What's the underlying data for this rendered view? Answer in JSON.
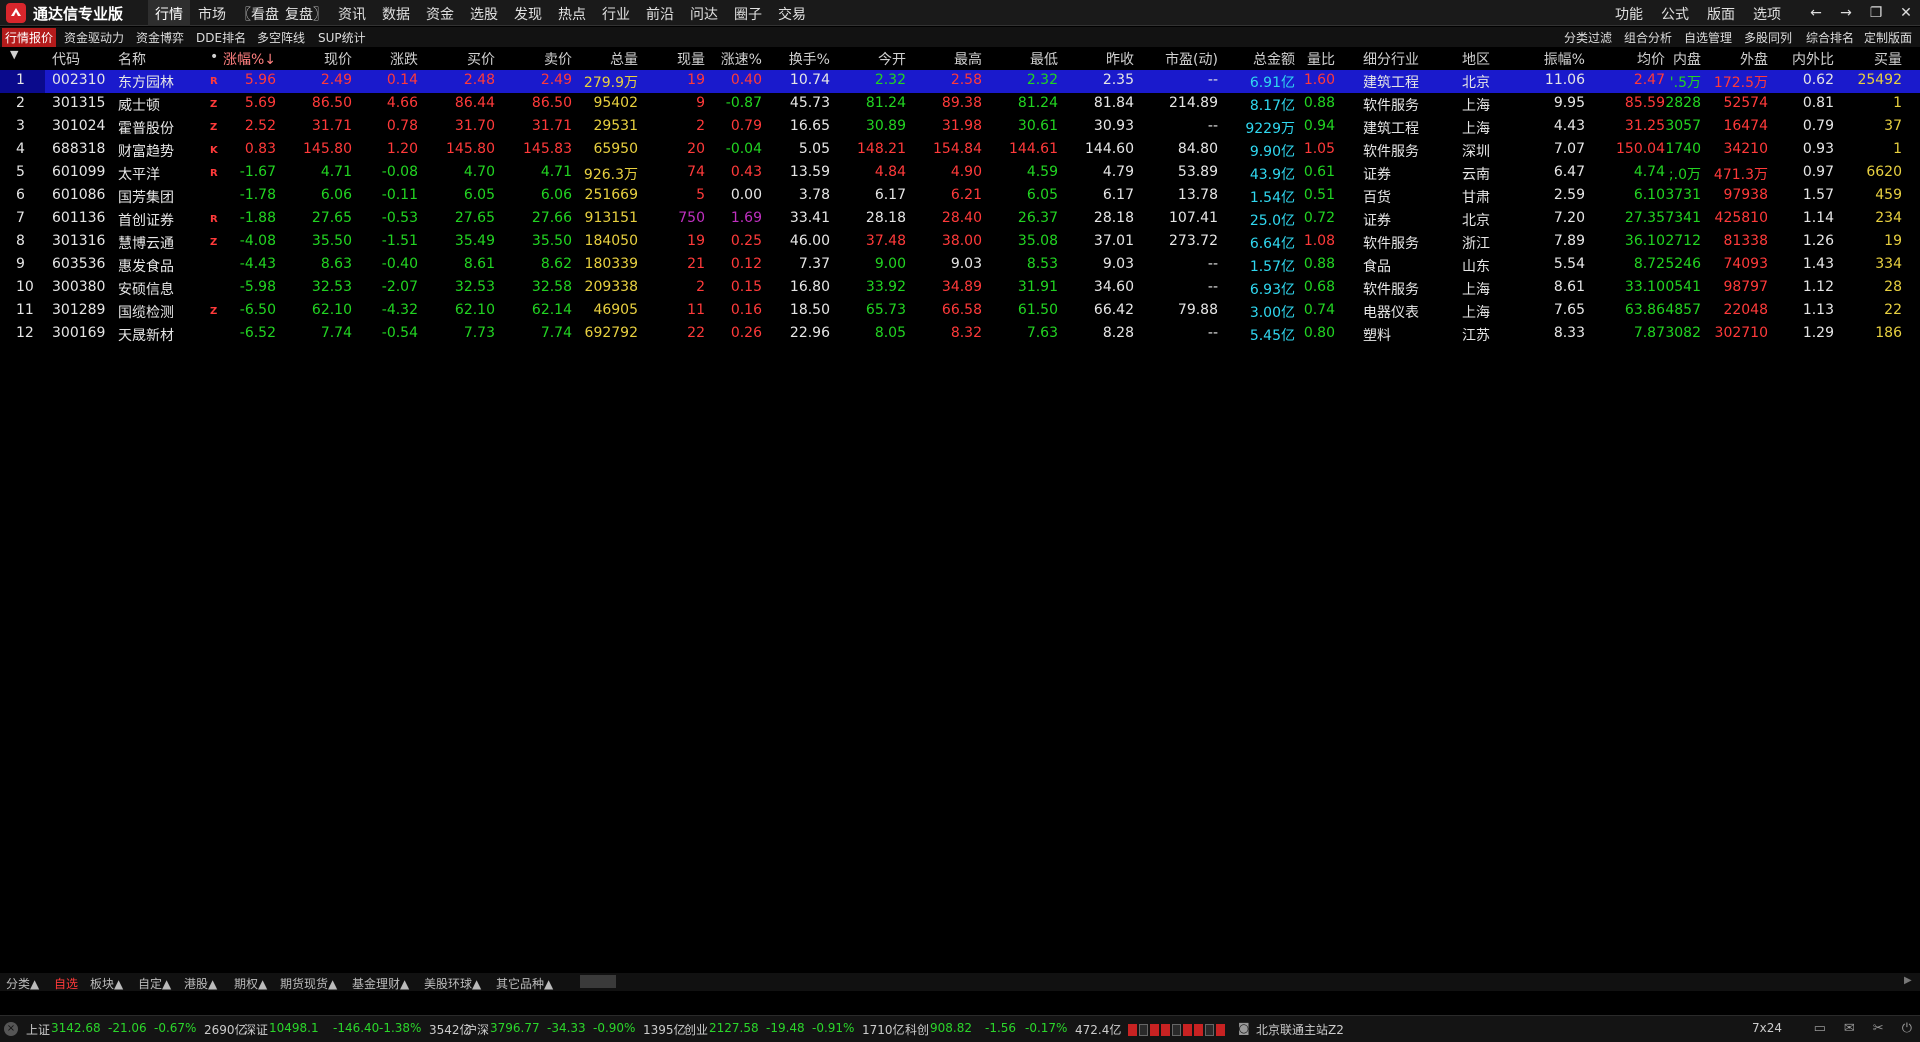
{
  "app": {
    "title": "通达信专业版"
  },
  "menu": [
    "行情",
    "市场",
    "〖看盘",
    "复盘〗",
    "资讯",
    "数据",
    "资金",
    "选股",
    "发现",
    "热点",
    "行业",
    "前沿",
    "问达",
    "圈子",
    "交易"
  ],
  "right_menu": [
    "功能",
    "公式",
    "版面",
    "选项"
  ],
  "window_controls": {
    "back": "←",
    "forward": "→",
    "restore": "❐",
    "close": "✕"
  },
  "subtabs": [
    "行情报价",
    "资金驱动力",
    "资金博弈",
    "DDE排名",
    "多空阵线",
    "SUP统计"
  ],
  "right_subtabs": [
    "分类过滤",
    "组合分析",
    "自选管理",
    "多股同列",
    "综合排名",
    "定制版面"
  ],
  "columns": [
    "代码",
    "名称",
    "•",
    "涨幅%↓",
    "现价",
    "涨跌",
    "买价",
    "卖价",
    "总量",
    "现量",
    "涨速%",
    "换手%",
    "今开",
    "最高",
    "最低",
    "昨收",
    "市盈(动)",
    "总金额",
    "量比",
    "细分行业",
    "地区",
    "振幅%",
    "均价",
    "内盘",
    "外盘",
    "内外比",
    "买量"
  ],
  "rows": [
    {
      "no": "1",
      "code": "002310",
      "name": "东方园林",
      "flag": "R",
      "chg_pct": "5.96",
      "price": "2.49",
      "chg": "0.14",
      "bid": "2.48",
      "ask": "2.49",
      "vol": "279.9万",
      "cur_vol": "19",
      "speed": "0.40",
      "turnover": "10.74",
      "open": "2.32",
      "high": "2.58",
      "low": "2.32",
      "prev": "2.35",
      "pe": "--",
      "amount": "6.91亿",
      "vol_ratio": "1.60",
      "industry": "建筑工程",
      "region": "北京",
      "amplitude": "11.06",
      "avg": "2.47",
      "inner": "'.5万",
      "outer": "172.5万",
      "io_ratio": "0.62",
      "bid_vol": "25492"
    },
    {
      "no": "2",
      "code": "301315",
      "name": "威士顿",
      "flag": "Z",
      "chg_pct": "5.69",
      "price": "86.50",
      "chg": "4.66",
      "bid": "86.44",
      "ask": "86.50",
      "vol": "95402",
      "cur_vol": "9",
      "speed": "-0.87",
      "turnover": "45.73",
      "open": "81.24",
      "high": "89.38",
      "low": "81.24",
      "prev": "81.84",
      "pe": "214.89",
      "amount": "8.17亿",
      "vol_ratio": "0.88",
      "industry": "软件服务",
      "region": "上海",
      "amplitude": "9.95",
      "avg": "85.59",
      "inner": "2828",
      "outer": "52574",
      "io_ratio": "0.81",
      "bid_vol": "1"
    },
    {
      "no": "3",
      "code": "301024",
      "name": "霍普股份",
      "flag": "Z",
      "chg_pct": "2.52",
      "price": "31.71",
      "chg": "0.78",
      "bid": "31.70",
      "ask": "31.71",
      "vol": "29531",
      "cur_vol": "2",
      "speed": "0.79",
      "turnover": "16.65",
      "open": "30.89",
      "high": "31.98",
      "low": "30.61",
      "prev": "30.93",
      "pe": "--",
      "amount": "9229万",
      "vol_ratio": "0.94",
      "industry": "建筑工程",
      "region": "上海",
      "amplitude": "4.43",
      "avg": "31.25",
      "inner": "3057",
      "outer": "16474",
      "io_ratio": "0.79",
      "bid_vol": "37"
    },
    {
      "no": "4",
      "code": "688318",
      "name": "财富趋势",
      "flag": "K",
      "chg_pct": "0.83",
      "price": "145.80",
      "chg": "1.20",
      "bid": "145.80",
      "ask": "145.83",
      "vol": "65950",
      "cur_vol": "20",
      "speed": "-0.04",
      "turnover": "5.05",
      "open": "148.21",
      "high": "154.84",
      "low": "144.61",
      "prev": "144.60",
      "pe": "84.80",
      "amount": "9.90亿",
      "vol_ratio": "1.05",
      "industry": "软件服务",
      "region": "深圳",
      "amplitude": "7.07",
      "avg": "150.04",
      "inner": "1740",
      "outer": "34210",
      "io_ratio": "0.93",
      "bid_vol": "1"
    },
    {
      "no": "5",
      "code": "601099",
      "name": "太平洋",
      "flag": "R",
      "chg_pct": "-1.67",
      "price": "4.71",
      "chg": "-0.08",
      "bid": "4.70",
      "ask": "4.71",
      "vol": "926.3万",
      "cur_vol": "74",
      "speed": "0.43",
      "turnover": "13.59",
      "open": "4.84",
      "high": "4.90",
      "low": "4.59",
      "prev": "4.79",
      "pe": "53.89",
      "amount": "43.9亿",
      "vol_ratio": "0.61",
      "industry": "证券",
      "region": "云南",
      "amplitude": "6.47",
      "avg": "4.74",
      "inner": ";.0万",
      "outer": "471.3万",
      "io_ratio": "0.97",
      "bid_vol": "6620"
    },
    {
      "no": "6",
      "code": "601086",
      "name": "国芳集团",
      "flag": "",
      "chg_pct": "-1.78",
      "price": "6.06",
      "chg": "-0.11",
      "bid": "6.05",
      "ask": "6.06",
      "vol": "251669",
      "cur_vol": "5",
      "speed": "0.00",
      "turnover": "3.78",
      "open": "6.17",
      "high": "6.21",
      "low": "6.05",
      "prev": "6.17",
      "pe": "13.78",
      "amount": "1.54亿",
      "vol_ratio": "0.51",
      "industry": "百货",
      "region": "甘肃",
      "amplitude": "2.59",
      "avg": "6.10",
      "inner": "3731",
      "outer": "97938",
      "io_ratio": "1.57",
      "bid_vol": "459"
    },
    {
      "no": "7",
      "code": "601136",
      "name": "首创证券",
      "flag": "R",
      "chg_pct": "-1.88",
      "price": "27.65",
      "chg": "-0.53",
      "bid": "27.65",
      "ask": "27.66",
      "vol": "913151",
      "cur_vol": "750",
      "speed": "1.69",
      "turnover": "33.41",
      "open": "28.18",
      "high": "28.40",
      "low": "26.37",
      "prev": "28.18",
      "pe": "107.41",
      "amount": "25.0亿",
      "vol_ratio": "0.72",
      "industry": "证券",
      "region": "北京",
      "amplitude": "7.20",
      "avg": "27.35",
      "inner": "7341",
      "outer": "425810",
      "io_ratio": "1.14",
      "bid_vol": "234"
    },
    {
      "no": "8",
      "code": "301316",
      "name": "慧博云通",
      "flag": "Z",
      "chg_pct": "-4.08",
      "price": "35.50",
      "chg": "-1.51",
      "bid": "35.49",
      "ask": "35.50",
      "vol": "184050",
      "cur_vol": "19",
      "speed": "0.25",
      "turnover": "46.00",
      "open": "37.48",
      "high": "38.00",
      "low": "35.08",
      "prev": "37.01",
      "pe": "273.72",
      "amount": "6.64亿",
      "vol_ratio": "1.08",
      "industry": "软件服务",
      "region": "浙江",
      "amplitude": "7.89",
      "avg": "36.10",
      "inner": "2712",
      "outer": "81338",
      "io_ratio": "1.26",
      "bid_vol": "19"
    },
    {
      "no": "9",
      "code": "603536",
      "name": "惠发食品",
      "flag": "",
      "chg_pct": "-4.43",
      "price": "8.63",
      "chg": "-0.40",
      "bid": "8.61",
      "ask": "8.62",
      "vol": "180339",
      "cur_vol": "21",
      "speed": "0.12",
      "turnover": "7.37",
      "open": "9.00",
      "high": "9.03",
      "low": "8.53",
      "prev": "9.03",
      "pe": "--",
      "amount": "1.57亿",
      "vol_ratio": "0.88",
      "industry": "食品",
      "region": "山东",
      "amplitude": "5.54",
      "avg": "8.72",
      "inner": "5246",
      "outer": "74093",
      "io_ratio": "1.43",
      "bid_vol": "334"
    },
    {
      "no": "10",
      "code": "300380",
      "name": "安硕信息",
      "flag": "",
      "chg_pct": "-5.98",
      "price": "32.53",
      "chg": "-2.07",
      "bid": "32.53",
      "ask": "32.58",
      "vol": "209338",
      "cur_vol": "2",
      "speed": "0.15",
      "turnover": "16.80",
      "open": "33.92",
      "high": "34.89",
      "low": "31.91",
      "prev": "34.60",
      "pe": "--",
      "amount": "6.93亿",
      "vol_ratio": "0.68",
      "industry": "软件服务",
      "region": "上海",
      "amplitude": "8.61",
      "avg": "33.10",
      "inner": "0541",
      "outer": "98797",
      "io_ratio": "1.12",
      "bid_vol": "28"
    },
    {
      "no": "11",
      "code": "301289",
      "name": "国缆检测",
      "flag": "Z",
      "chg_pct": "-6.50",
      "price": "62.10",
      "chg": "-4.32",
      "bid": "62.10",
      "ask": "62.14",
      "vol": "46905",
      "cur_vol": "11",
      "speed": "0.16",
      "turnover": "18.50",
      "open": "65.73",
      "high": "66.58",
      "low": "61.50",
      "prev": "66.42",
      "pe": "79.88",
      "amount": "3.00亿",
      "vol_ratio": "0.74",
      "industry": "电器仪表",
      "region": "上海",
      "amplitude": "7.65",
      "avg": "63.86",
      "inner": "4857",
      "outer": "22048",
      "io_ratio": "1.13",
      "bid_vol": "22"
    },
    {
      "no": "12",
      "code": "300169",
      "name": "天晟新材",
      "flag": "",
      "chg_pct": "-6.52",
      "price": "7.74",
      "chg": "-0.54",
      "bid": "7.73",
      "ask": "7.74",
      "vol": "692792",
      "cur_vol": "22",
      "speed": "0.26",
      "turnover": "22.96",
      "open": "8.05",
      "high": "8.32",
      "low": "7.63",
      "prev": "8.28",
      "pe": "--",
      "amount": "5.45亿",
      "vol_ratio": "0.80",
      "industry": "塑料",
      "region": "江苏",
      "amplitude": "8.33",
      "avg": "7.87",
      "inner": "3082",
      "outer": "302710",
      "io_ratio": "1.29",
      "bid_vol": "186"
    }
  ],
  "category_tabs": [
    "分类▲",
    "自选",
    "板块▲",
    "自定▲",
    "港股▲",
    "期权▲",
    "期货现货▲",
    "基金理财▲",
    "美股环球▲",
    "其它品种▲"
  ],
  "status": {
    "close": "×",
    "sh": {
      "name": "上证",
      "value": "3142.68",
      "chg": "-21.06",
      "pct": "-0.67%",
      "amt": "2690亿"
    },
    "sz": {
      "name": "深证",
      "value": "10498.1",
      "chg": "-146.40",
      "pct": "-1.38%",
      "amt": "3542亿"
    },
    "hs": {
      "name": "沪深",
      "value": "3796.77",
      "chg": "-34.33",
      "pct": "-0.90%",
      "amt": "1395亿"
    },
    "cy": {
      "name": "创业",
      "value": "2127.58",
      "chg": "-19.48",
      "pct": "-0.91%",
      "amt": "1710亿"
    },
    "kc": {
      "name": "科创",
      "value": "908.82",
      "chg": "-1.56",
      "pct": "-0.17%",
      "amt": "472.4亿"
    },
    "server": "北京联通主站Z2",
    "session": "7x24"
  }
}
